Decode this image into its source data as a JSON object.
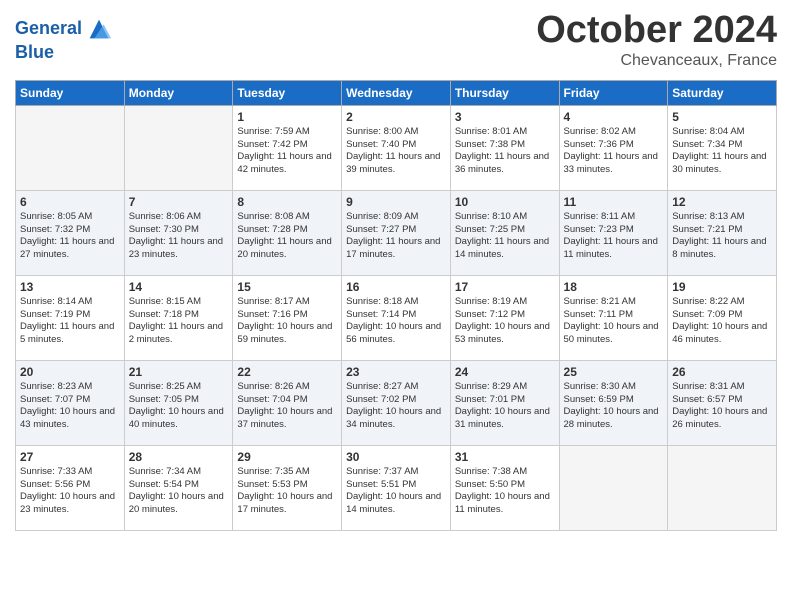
{
  "header": {
    "logo_line1": "General",
    "logo_line2": "Blue",
    "month": "October 2024",
    "location": "Chevanceaux, France"
  },
  "weekdays": [
    "Sunday",
    "Monday",
    "Tuesday",
    "Wednesday",
    "Thursday",
    "Friday",
    "Saturday"
  ],
  "weeks": [
    [
      {
        "day": "",
        "empty": true
      },
      {
        "day": "",
        "empty": true
      },
      {
        "day": "1",
        "sunrise": "Sunrise: 7:59 AM",
        "sunset": "Sunset: 7:42 PM",
        "daylight": "Daylight: 11 hours and 42 minutes."
      },
      {
        "day": "2",
        "sunrise": "Sunrise: 8:00 AM",
        "sunset": "Sunset: 7:40 PM",
        "daylight": "Daylight: 11 hours and 39 minutes."
      },
      {
        "day": "3",
        "sunrise": "Sunrise: 8:01 AM",
        "sunset": "Sunset: 7:38 PM",
        "daylight": "Daylight: 11 hours and 36 minutes."
      },
      {
        "day": "4",
        "sunrise": "Sunrise: 8:02 AM",
        "sunset": "Sunset: 7:36 PM",
        "daylight": "Daylight: 11 hours and 33 minutes."
      },
      {
        "day": "5",
        "sunrise": "Sunrise: 8:04 AM",
        "sunset": "Sunset: 7:34 PM",
        "daylight": "Daylight: 11 hours and 30 minutes."
      }
    ],
    [
      {
        "day": "6",
        "sunrise": "Sunrise: 8:05 AM",
        "sunset": "Sunset: 7:32 PM",
        "daylight": "Daylight: 11 hours and 27 minutes."
      },
      {
        "day": "7",
        "sunrise": "Sunrise: 8:06 AM",
        "sunset": "Sunset: 7:30 PM",
        "daylight": "Daylight: 11 hours and 23 minutes."
      },
      {
        "day": "8",
        "sunrise": "Sunrise: 8:08 AM",
        "sunset": "Sunset: 7:28 PM",
        "daylight": "Daylight: 11 hours and 20 minutes."
      },
      {
        "day": "9",
        "sunrise": "Sunrise: 8:09 AM",
        "sunset": "Sunset: 7:27 PM",
        "daylight": "Daylight: 11 hours and 17 minutes."
      },
      {
        "day": "10",
        "sunrise": "Sunrise: 8:10 AM",
        "sunset": "Sunset: 7:25 PM",
        "daylight": "Daylight: 11 hours and 14 minutes."
      },
      {
        "day": "11",
        "sunrise": "Sunrise: 8:11 AM",
        "sunset": "Sunset: 7:23 PM",
        "daylight": "Daylight: 11 hours and 11 minutes."
      },
      {
        "day": "12",
        "sunrise": "Sunrise: 8:13 AM",
        "sunset": "Sunset: 7:21 PM",
        "daylight": "Daylight: 11 hours and 8 minutes."
      }
    ],
    [
      {
        "day": "13",
        "sunrise": "Sunrise: 8:14 AM",
        "sunset": "Sunset: 7:19 PM",
        "daylight": "Daylight: 11 hours and 5 minutes."
      },
      {
        "day": "14",
        "sunrise": "Sunrise: 8:15 AM",
        "sunset": "Sunset: 7:18 PM",
        "daylight": "Daylight: 11 hours and 2 minutes."
      },
      {
        "day": "15",
        "sunrise": "Sunrise: 8:17 AM",
        "sunset": "Sunset: 7:16 PM",
        "daylight": "Daylight: 10 hours and 59 minutes."
      },
      {
        "day": "16",
        "sunrise": "Sunrise: 8:18 AM",
        "sunset": "Sunset: 7:14 PM",
        "daylight": "Daylight: 10 hours and 56 minutes."
      },
      {
        "day": "17",
        "sunrise": "Sunrise: 8:19 AM",
        "sunset": "Sunset: 7:12 PM",
        "daylight": "Daylight: 10 hours and 53 minutes."
      },
      {
        "day": "18",
        "sunrise": "Sunrise: 8:21 AM",
        "sunset": "Sunset: 7:11 PM",
        "daylight": "Daylight: 10 hours and 50 minutes."
      },
      {
        "day": "19",
        "sunrise": "Sunrise: 8:22 AM",
        "sunset": "Sunset: 7:09 PM",
        "daylight": "Daylight: 10 hours and 46 minutes."
      }
    ],
    [
      {
        "day": "20",
        "sunrise": "Sunrise: 8:23 AM",
        "sunset": "Sunset: 7:07 PM",
        "daylight": "Daylight: 10 hours and 43 minutes."
      },
      {
        "day": "21",
        "sunrise": "Sunrise: 8:25 AM",
        "sunset": "Sunset: 7:05 PM",
        "daylight": "Daylight: 10 hours and 40 minutes."
      },
      {
        "day": "22",
        "sunrise": "Sunrise: 8:26 AM",
        "sunset": "Sunset: 7:04 PM",
        "daylight": "Daylight: 10 hours and 37 minutes."
      },
      {
        "day": "23",
        "sunrise": "Sunrise: 8:27 AM",
        "sunset": "Sunset: 7:02 PM",
        "daylight": "Daylight: 10 hours and 34 minutes."
      },
      {
        "day": "24",
        "sunrise": "Sunrise: 8:29 AM",
        "sunset": "Sunset: 7:01 PM",
        "daylight": "Daylight: 10 hours and 31 minutes."
      },
      {
        "day": "25",
        "sunrise": "Sunrise: 8:30 AM",
        "sunset": "Sunset: 6:59 PM",
        "daylight": "Daylight: 10 hours and 28 minutes."
      },
      {
        "day": "26",
        "sunrise": "Sunrise: 8:31 AM",
        "sunset": "Sunset: 6:57 PM",
        "daylight": "Daylight: 10 hours and 26 minutes."
      }
    ],
    [
      {
        "day": "27",
        "sunrise": "Sunrise: 7:33 AM",
        "sunset": "Sunset: 5:56 PM",
        "daylight": "Daylight: 10 hours and 23 minutes."
      },
      {
        "day": "28",
        "sunrise": "Sunrise: 7:34 AM",
        "sunset": "Sunset: 5:54 PM",
        "daylight": "Daylight: 10 hours and 20 minutes."
      },
      {
        "day": "29",
        "sunrise": "Sunrise: 7:35 AM",
        "sunset": "Sunset: 5:53 PM",
        "daylight": "Daylight: 10 hours and 17 minutes."
      },
      {
        "day": "30",
        "sunrise": "Sunrise: 7:37 AM",
        "sunset": "Sunset: 5:51 PM",
        "daylight": "Daylight: 10 hours and 14 minutes."
      },
      {
        "day": "31",
        "sunrise": "Sunrise: 7:38 AM",
        "sunset": "Sunset: 5:50 PM",
        "daylight": "Daylight: 10 hours and 11 minutes."
      },
      {
        "day": "",
        "empty": true
      },
      {
        "day": "",
        "empty": true
      }
    ]
  ]
}
